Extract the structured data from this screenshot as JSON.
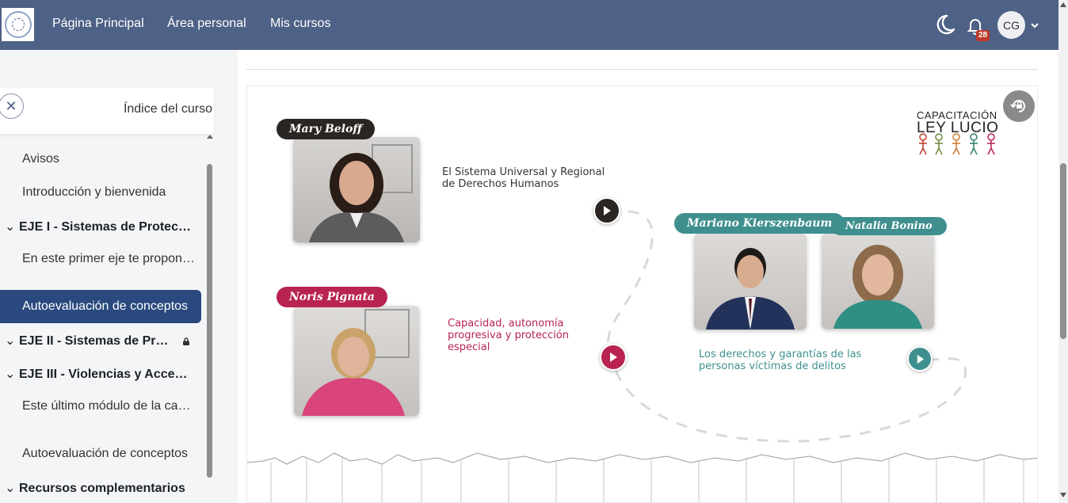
{
  "navbar": {
    "links": [
      "Página Principal",
      "Área personal",
      "Mis cursos"
    ],
    "notifications_count": "28",
    "avatar_initials": "CG",
    "icons": {
      "theme": "moon-icon",
      "notifications": "bell-icon",
      "menu": "chevron-down-icon"
    }
  },
  "sidebar": {
    "title": "Índice del curso",
    "items": [
      {
        "label": "Avisos"
      },
      {
        "label": "Introducción y bienvenida"
      },
      {
        "label": "EJE I - Sistemas de Protección de Derechos"
      },
      {
        "label": "En este primer eje te proponemos"
      },
      {
        "label": "Autoevaluación de conceptos"
      },
      {
        "label": "EJE II - Sistemas de Protección"
      },
      {
        "label": "EJE III - Violencias y Acceso a la Justicia"
      },
      {
        "label": "Este último módulo de la capacitación"
      },
      {
        "label": "Autoevaluación de conceptos"
      },
      {
        "label": "Recursos complementarios"
      }
    ],
    "active_index": 4
  },
  "content": {
    "brand": {
      "line1": "CAPACITACIÓN",
      "line2": "LEY LUCIO"
    },
    "speakers": {
      "mary": "Mary Beloff",
      "noris": "Noris Pignata",
      "mariano": "Mariano Kierszenbaum",
      "natalia": "Natalia Bonino"
    },
    "topics": {
      "t1": "El Sistema Universal y Regional de Derechos Humanos",
      "t2": "Capacidad, autonomía progresiva y protección especial",
      "t3": "Los derechos y garantías de las personas víctimas de delitos"
    },
    "colors": {
      "dark": "#2b2623",
      "magenta": "#b8234f",
      "teal": "#3f8f8e",
      "navbar": "#4e6186",
      "active": "#2a4a7f"
    }
  }
}
